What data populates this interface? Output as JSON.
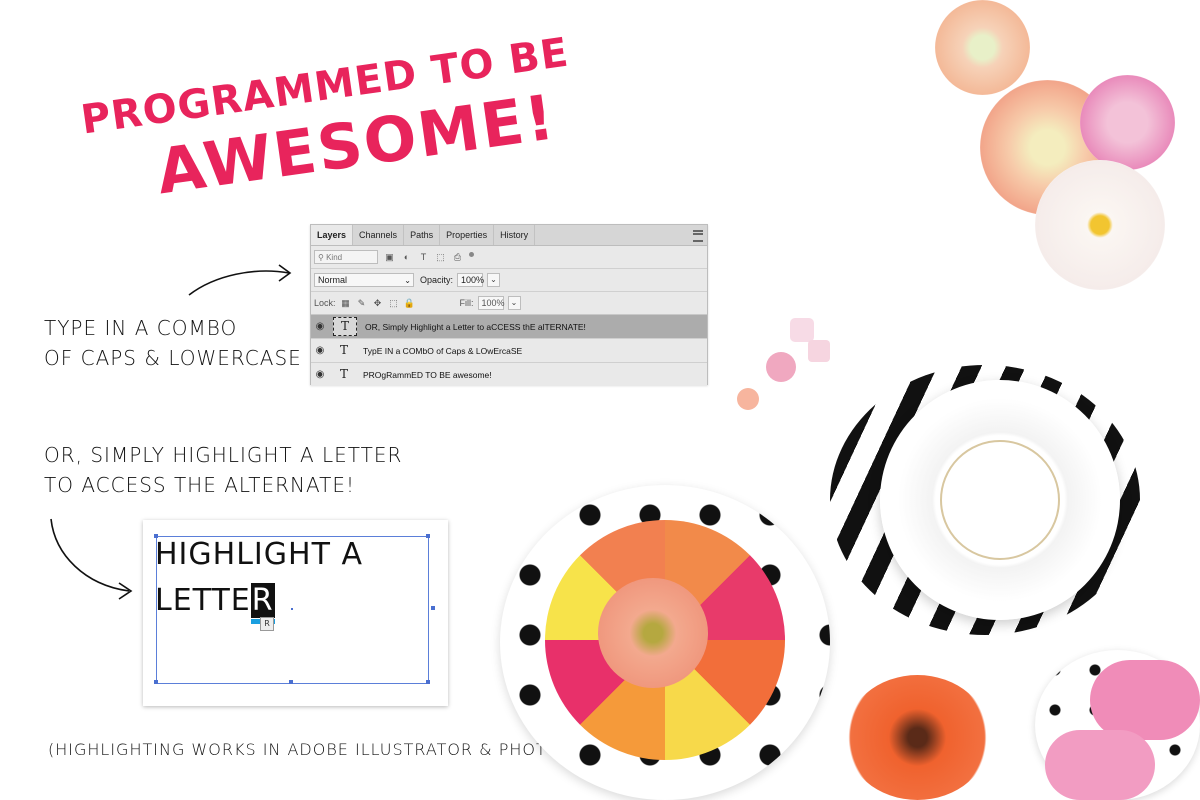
{
  "headline": {
    "line1": "PROGRAMMED TO BE",
    "line2": "AWESOME!"
  },
  "notes": {
    "type_in": [
      "TYPE IN A COMBO",
      "OF CAPS & LOWERCASE"
    ],
    "highlight": [
      "OR, SIMPLY HIGHLIGHT A LETTER",
      "TO ACCESS THE ALTERNATE!"
    ],
    "footer": "(HIGHLIGHTING WORKS IN ADOBE ILLUSTRATOR & PHOTOSHOP.)"
  },
  "layers_panel": {
    "tabs": [
      "Layers",
      "Channels",
      "Paths",
      "Properties",
      "History"
    ],
    "active_tab": "Layers",
    "filter_kind": "Kind",
    "blend_mode": "Normal",
    "opacity_label": "Opacity:",
    "opacity_value": "100%",
    "lock_label": "Lock:",
    "fill_label": "Fill:",
    "fill_value": "100%",
    "layers": [
      {
        "name": "OR, Simply Highlight a Letter  to aCCESS thE alTERNATE!",
        "selected": true,
        "type_glyph": "T"
      },
      {
        "name": "TypE IN a COMbO of Caps & LOwErcaSE",
        "selected": false,
        "type_glyph": "T"
      },
      {
        "name": "PROgRammED TO BE awesome!",
        "selected": false,
        "type_glyph": "T"
      }
    ]
  },
  "highlight_card": {
    "line1": "HIGHLIGHT A",
    "line2_prefix": "LETTE",
    "highlighted_letter": "R",
    "alternate_glyph": "R"
  },
  "colors": {
    "headline": "#e8245c",
    "selection_blue": "#1a9fe0",
    "bbox": "#5b7fd9"
  }
}
